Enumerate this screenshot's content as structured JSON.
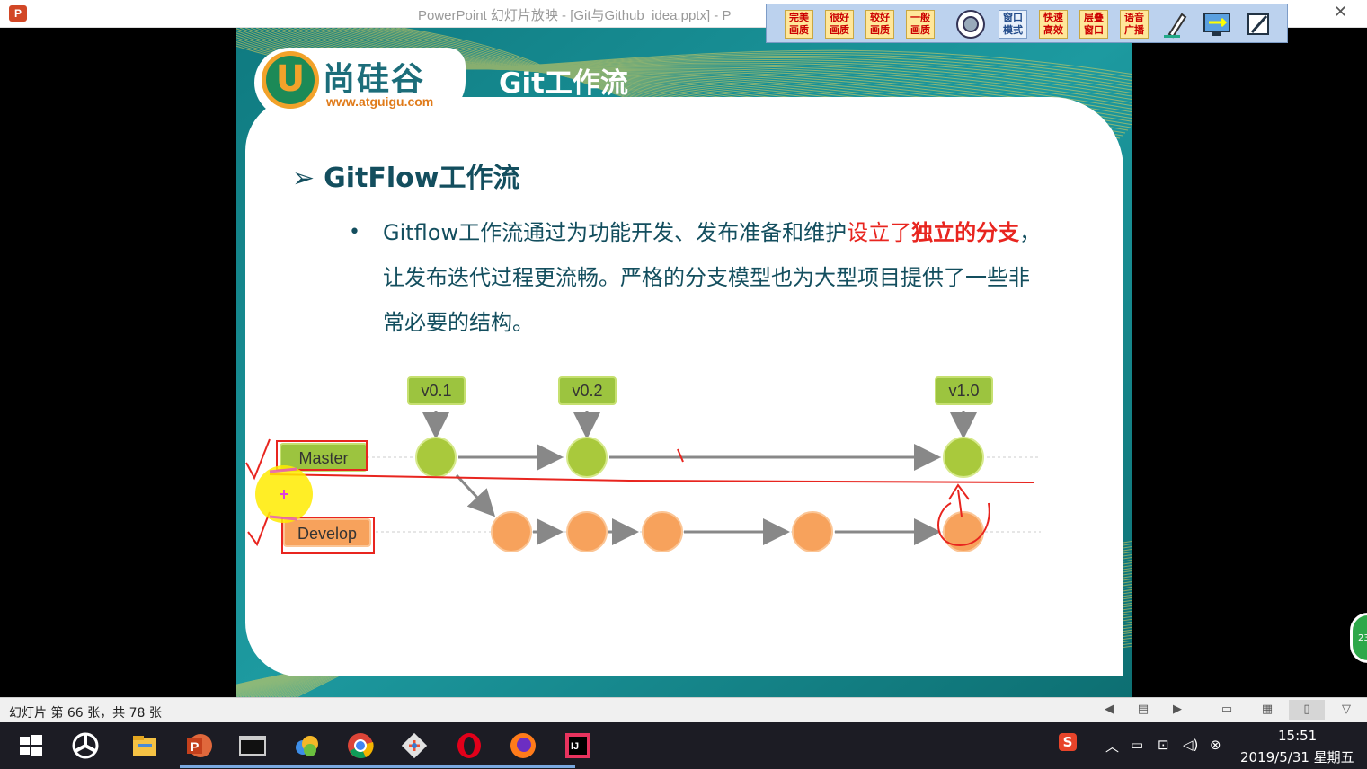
{
  "window": {
    "app_icon": "P",
    "title": "PowerPoint 幻灯片放映 - [Git与Github_idea.pptx] - P",
    "close_glyph": "✕"
  },
  "quality_toolbar": {
    "buttons": [
      "完美画质",
      "很好画质",
      "较好画质",
      "一般画质",
      "窗口模式",
      "快速高效",
      "层叠窗口",
      "语音广播"
    ],
    "icons": [
      "speaker-icon",
      "pen-icon",
      "screen-share-icon",
      "clear-icon"
    ]
  },
  "slide": {
    "logo_text": "尚硅谷",
    "logo_letter": "U",
    "logo_url": "www.atguigu.com",
    "title": "Git工作流",
    "heading_marker": "➢",
    "heading": "GitFlow工作流",
    "bullet_marker": "•",
    "bullet_part1": "Gitflow工作流通过为功能开发、发布准备和维护",
    "bullet_highlight1": "设立了",
    "bullet_highlight2": "独立的分支",
    "bullet_part2": "，让发布迭代过程更流畅。严格的分支模型也为大型项目提供了一些非常必要的结构。",
    "diagram": {
      "tags": [
        "v0.1",
        "v0.2",
        "v1.0"
      ],
      "branches": [
        "Master",
        "Develop"
      ],
      "colors": {
        "master": "#9cc43f",
        "develop": "#f7a25c",
        "arrow": "#888888",
        "ink": "#e8251f"
      }
    }
  },
  "statusbar": {
    "slide_counter": "幻灯片 第 66 张，共 78 张"
  },
  "side_badge": "23",
  "taskbar": {
    "apps": [
      "start-icon",
      "fan-icon",
      "file-explorer-icon",
      "powerpoint-icon",
      "terminal-icon",
      "cloud-icon",
      "chrome-icon",
      "git-icon",
      "opera-icon",
      "firefox-icon",
      "intellij-icon"
    ],
    "clock_time": "15:51",
    "clock_date": "2019/5/31 星期五",
    "ime_icon": "S"
  }
}
